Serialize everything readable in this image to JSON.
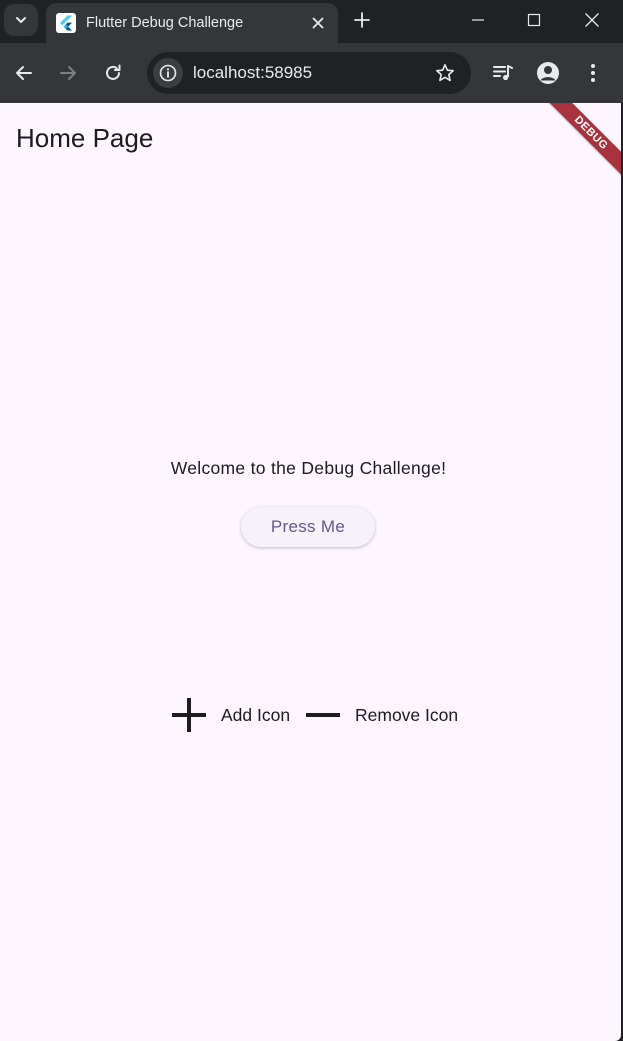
{
  "browser": {
    "tab": {
      "title": "Flutter Debug Challenge",
      "favicon": "flutter-logo-icon"
    },
    "omnibox": {
      "url": "localhost:58985"
    },
    "colors": {
      "frame": "#202124",
      "toolbar": "#35363a",
      "text": "#e8eaed"
    }
  },
  "app": {
    "appbar_title": "Home Page",
    "debug_banner": "DEBUG",
    "welcome_text": "Welcome to the Debug Challenge!",
    "press_button_label": "Press Me",
    "icons": {
      "add_label": "Add Icon",
      "remove_label": "Remove Icon"
    },
    "colors": {
      "background": "#fdf6fe",
      "primary": "#65558f",
      "banner": "#a8323d"
    }
  }
}
